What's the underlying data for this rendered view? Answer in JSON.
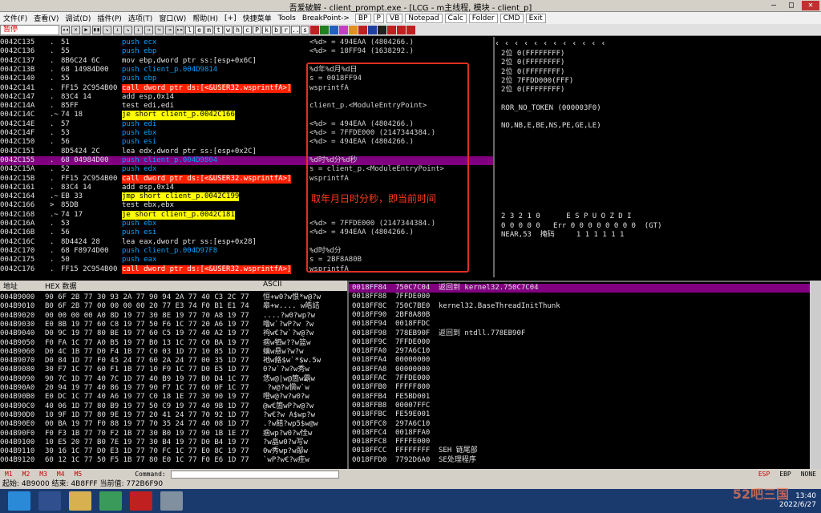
{
  "window": {
    "title": "吾爱破解 - client_prompt.exe - [LCG - m主线程, 模块 - client_p]"
  },
  "menu": [
    "文件(F)",
    "查看(V)",
    "调试(D)",
    "插件(P)",
    "选项(T)",
    "窗口(W)",
    "帮助(H)",
    "[+]",
    "快捷菜单",
    "Tools",
    "BreakPoint->"
  ],
  "menu_tools": [
    "BP",
    "P",
    "VB",
    "Notepad",
    "Calc",
    "Folder",
    "CMD",
    "Exit"
  ],
  "toolbar": {
    "state": "暂停",
    "letters": [
      "l",
      "e",
      "m",
      "t",
      "w",
      "h",
      "c",
      "P",
      "k",
      "b",
      "r",
      "...",
      "s"
    ]
  },
  "cpu_rows": [
    {
      "a": "0042C135",
      "m": ".",
      "h": "51",
      "i": "push ecx",
      "k": "push",
      "c": "<%d> = 494EAA (4804266.)"
    },
    {
      "a": "0042C136",
      "m": ".",
      "h": "55",
      "i": "push ebp",
      "k": "push",
      "c": "<%d> = 18FF94 (1638292.)"
    },
    {
      "a": "0042C137",
      "m": ".",
      "h": "8B6C24 6C",
      "i": "mov ebp,dword ptr ss:[esp+0x6C]",
      "k": "mov",
      "c": ""
    },
    {
      "a": "0042C13B",
      "m": ".",
      "h": "68 14984D00",
      "i": "push client_p.004D9814",
      "k": "push",
      "c": "%d年%d月%d日"
    },
    {
      "a": "0042C140",
      "m": ".",
      "h": "55",
      "i": "push ebp",
      "k": "push",
      "c": "s = 0018FF94"
    },
    {
      "a": "0042C141",
      "m": ".",
      "h": "FF15 2C954B00",
      "i": "call dword ptr ds:[<&USER32.wsprintfA>]",
      "k": "call",
      "c": "wsprintfA"
    },
    {
      "a": "0042C147",
      "m": ".",
      "h": "83C4 14",
      "i": "add esp,0x14",
      "k": "mov",
      "c": ""
    },
    {
      "a": "0042C14A",
      "m": ".",
      "h": "85FF",
      "i": "test edi,edi",
      "k": "mov",
      "c": "client_p.<ModuleEntryPoint>"
    },
    {
      "a": "0042C14C",
      "m": ".~",
      "h": "74 18",
      "i": "je short client_p.0042C166",
      "k": "jmp",
      "c": ""
    },
    {
      "a": "0042C14E",
      "m": ".",
      "h": "57",
      "i": "push edi",
      "k": "push",
      "c": "<%d> = 494EAA (4804266.)"
    },
    {
      "a": "0042C14F",
      "m": ".",
      "h": "53",
      "i": "push ebx",
      "k": "push",
      "c": "<%d> = 7FFDE000 (2147344384.)"
    },
    {
      "a": "0042C150",
      "m": ".",
      "h": "56",
      "i": "push esi",
      "k": "push",
      "c": "<%d> = 494EAA (4804266.)"
    },
    {
      "a": "0042C151",
      "m": ".",
      "h": "8D5424 2C",
      "i": "lea edx,dword ptr ss:[esp+0x2C]",
      "k": "mov",
      "c": ""
    },
    {
      "a": "0042C155",
      "m": ".",
      "h": "68 04984D00",
      "i": "push client_p.004D9804",
      "k": "push",
      "c": "%d时%d分%d秒",
      "sel": true
    },
    {
      "a": "0042C15A",
      "m": ".",
      "h": "52",
      "i": "push edx",
      "k": "push",
      "c": "s = client_p.<ModuleEntryPoint>"
    },
    {
      "a": "0042C15B",
      "m": ".",
      "h": "FF15 2C954B00",
      "i": "call dword ptr ds:[<&USER32.wsprintfA>]",
      "k": "call",
      "c": "wsprintfA"
    },
    {
      "a": "0042C161",
      "m": ".",
      "h": "83C4 14",
      "i": "add esp,0x14",
      "k": "mov",
      "c": ""
    },
    {
      "a": "0042C164",
      "m": ".~",
      "h": "EB 33",
      "i": "jmp short client_p.0042C199",
      "k": "jmp",
      "c": ""
    },
    {
      "a": "0042C166",
      "m": ">",
      "h": "85DB",
      "i": "test ebx,ebx",
      "k": "mov",
      "c": ""
    },
    {
      "a": "0042C168",
      "m": ".~",
      "h": "74 17",
      "i": "je short client_p.0042C181",
      "k": "jmp",
      "c": ""
    },
    {
      "a": "0042C16A",
      "m": ".",
      "h": "53",
      "i": "push ebx",
      "k": "push",
      "c": "<%d> = 7FFDE000 (2147344384.)"
    },
    {
      "a": "0042C16B",
      "m": ".",
      "h": "56",
      "i": "push esi",
      "k": "push",
      "c": "<%d> = 494EAA (4804266.)"
    },
    {
      "a": "0042C16C",
      "m": ".",
      "h": "8D4424 28",
      "i": "lea eax,dword ptr ss:[esp+0x28]",
      "k": "mov",
      "c": ""
    },
    {
      "a": "0042C170",
      "m": ".",
      "h": "68 F8974D00",
      "i": "push client_p.004D97F8",
      "k": "push",
      "c": "%d时%d分"
    },
    {
      "a": "0042C175",
      "m": ".",
      "h": "50",
      "i": "push eax",
      "k": "push",
      "c": "s = 2BF8A80B"
    },
    {
      "a": "0042C176",
      "m": ".",
      "h": "FF15 2C954B00",
      "i": "call dword ptr ds:[<&USER32.wsprintfA>]",
      "k": "call",
      "c": "wsprintfA"
    }
  ],
  "annotation": "取年月日时分秒，即当前时间",
  "regs": [
    "2位 0(FFFFFFFF)",
    "2位 0(FFFFFFFF)",
    "2位 0(FFFFFFFF)",
    "2位 7FFDD000(FFF)",
    "2位 0(FFFFFFFF)",
    "",
    "ROR_NO_TOKEN (000003F0)",
    "",
    "NO,NB,E,BE,NS,PE,GE,LE)",
    "",
    "",
    "",
    "",
    "",
    "",
    "",
    "",
    "",
    "2 3 2 1 0      E S P U O Z D I",
    "0 0 0 0 0   Err 0 0 0 0 0 0 0 0  (GT)",
    "NEAR,53  掩码     1 1 1 1 1 1"
  ],
  "dump": {
    "col_addr": "地址",
    "col_hex": "HEX 数据",
    "col_ascii": "ASCII",
    "rows": [
      [
        "004B9000",
        "90 6F 2B 77 30 93 2A 77 90 94 2A 77 40 C3 2C 77",
        "恒+w0?w恨*w@?w"
      ],
      [
        "004B9010",
        "B0 6F 2B 77 00 00 00 00 20 77 E3 74 F0 B1 E1 74",
        "皋+w.... w皓詰"
      ],
      [
        "004B9020",
        "00 00 00 00 A0 8D 19 77 30 8E 19 77 70 A8 19 77",
        "....?w0?wp?w"
      ],
      [
        "004B9030",
        "E0 8B 19 77 60 C8 19 77 50 F6 1C 77 20 A6 19 77",
        "噜w`?wP?w ?w"
      ],
      [
        "004B9040",
        "D0 9C 19 77 80 BE 19 77 60 C5 19 77 40 A2 19 77",
        "袧w€?w`?w@?w"
      ],
      [
        "004B9050",
        "F0 FA 1C 77 A0 B5 19 77 B0 13 1C 77 C0 BA 19 77",
        "痼w牭w??w篮w"
      ],
      [
        "004B9060",
        "D0 4C 1B 77 D0 F4 1B 77 C0 03 1D 77 10 85 1D 77",
        "蠰w悬w?w?w"
      ],
      [
        "004B9070",
        "D0 84 1D 77 F0 45 24 77 60 2A 24 77 00 35 1D 77",
        "衪w餎$w`*$w.5w"
      ],
      [
        "004B9080",
        "30 F7 1C 77 60 F1 1B 77 10 F9 1C 77 D0 E5 1D 77",
        "0?w`?w?w秀w"
      ],
      [
        "004B9090",
        "90 7C 1D 77 40 7C 1D 77 40 B9 19 77 B0 D4 1C 77",
        "恷w@|w@箇w霸w"
      ],
      [
        "004B90A0",
        "20 94 19 77 40 86 19 77 90 F7 1C 77 60 0F 1C 77",
        " ?w@?w愼w`w"
      ],
      [
        "004B90B0",
        "E0 DC 1C 77 40 A6 19 77 C0 18 1E 77 30 90 19 77",
        "噔w@?w?w0?w"
      ],
      [
        "004B90C0",
        "40 06 1D 77 80 B9 19 77 50 C9 19 77 40 9B 1D 77",
        "@w€箇wP?w@?w"
      ],
      [
        "004B90D0",
        "10 9F 1D 77 80 9E 19 77 20 41 24 77 70 92 1D 77",
        "?w€?w A$wp?w"
      ],
      [
        "004B90E0",
        "00 BA 19 77 F0 88 19 77 70 35 24 77 40 08 1D 77",
        ".?w餢?wp5$w@w"
      ],
      [
        "004B90F0",
        "F0 F3 1B 77 70 F2 1B 77 30 B0 19 77 90 1B 1E 77",
        "痼wp?w0?w恮w"
      ],
      [
        "004B9100",
        "10 E5 20 77 B0 7E 19 77 30 B4 19 77 D0 B4 19 77",
        "?w皛w0?w写w"
      ],
      [
        "004B9110",
        "30 16 1C 77 D0 E3 1D 77 70 FC 1C 77 E0 8C 19 77",
        "0w秀wp?w鄬w"
      ],
      [
        "004B9120",
        "60 12 1C 77 50 F5 1B 77 80 E0 1C 77 F0 E6 1D 77",
        "`wP?w€?w疰w"
      ]
    ]
  },
  "stack": [
    [
      "0018FF84",
      "750C7C04",
      "返回到 kernel32.750C7C04",
      true
    ],
    [
      "0018FF88",
      "7FFDE000",
      "",
      false
    ],
    [
      "0018FF8C",
      "750C7BE0",
      "kernel32.BaseThreadInitThunk",
      false
    ],
    [
      "0018FF90",
      "2BF8A80B",
      "",
      false
    ],
    [
      "0018FF94",
      "0018FFDC",
      "",
      false
    ],
    [
      "0018FF98",
      "778EB90F",
      "返回到 ntdll.778EB90F",
      false
    ],
    [
      "0018FF9C",
      "7FFDE000",
      "",
      false
    ],
    [
      "0018FFA0",
      "297A6C10",
      "",
      false
    ],
    [
      "0018FFA4",
      "00000000",
      "",
      false
    ],
    [
      "0018FFA8",
      "00000000",
      "",
      false
    ],
    [
      "0018FFAC",
      "7FFDE000",
      "",
      false
    ],
    [
      "0018FFB0",
      "FFFFF800",
      "",
      false
    ],
    [
      "0018FFB4",
      "FE5BD001",
      "",
      false
    ],
    [
      "0018FFB8",
      "00007FFC",
      "",
      false
    ],
    [
      "0018FFBC",
      "FE59E001",
      "",
      false
    ],
    [
      "0018FFC0",
      "297A6C10",
      "",
      false
    ],
    [
      "0018FFC4",
      "0018FFA0",
      "",
      false
    ],
    [
      "0018FFC8",
      "FFFFE000",
      "",
      false
    ],
    [
      "0018FFCC",
      "FFFFFFFF",
      "SEH 链尾部",
      false
    ],
    [
      "0018FFD0",
      "7792D6A0",
      "SE处理程序",
      false
    ]
  ],
  "cmdbar": {
    "labels": [
      "M1",
      "M2",
      "M3",
      "M4",
      "M5"
    ],
    "command_label": "Command:",
    "right": [
      "ESP",
      "EBP",
      "NONE"
    ]
  },
  "status": "起始: 4B9000  结束: 4B8FFF  当前值: 772B6F90",
  "clock": {
    "time": "13:40",
    "date": "2022/6/27"
  },
  "watermark": "52吧三国"
}
